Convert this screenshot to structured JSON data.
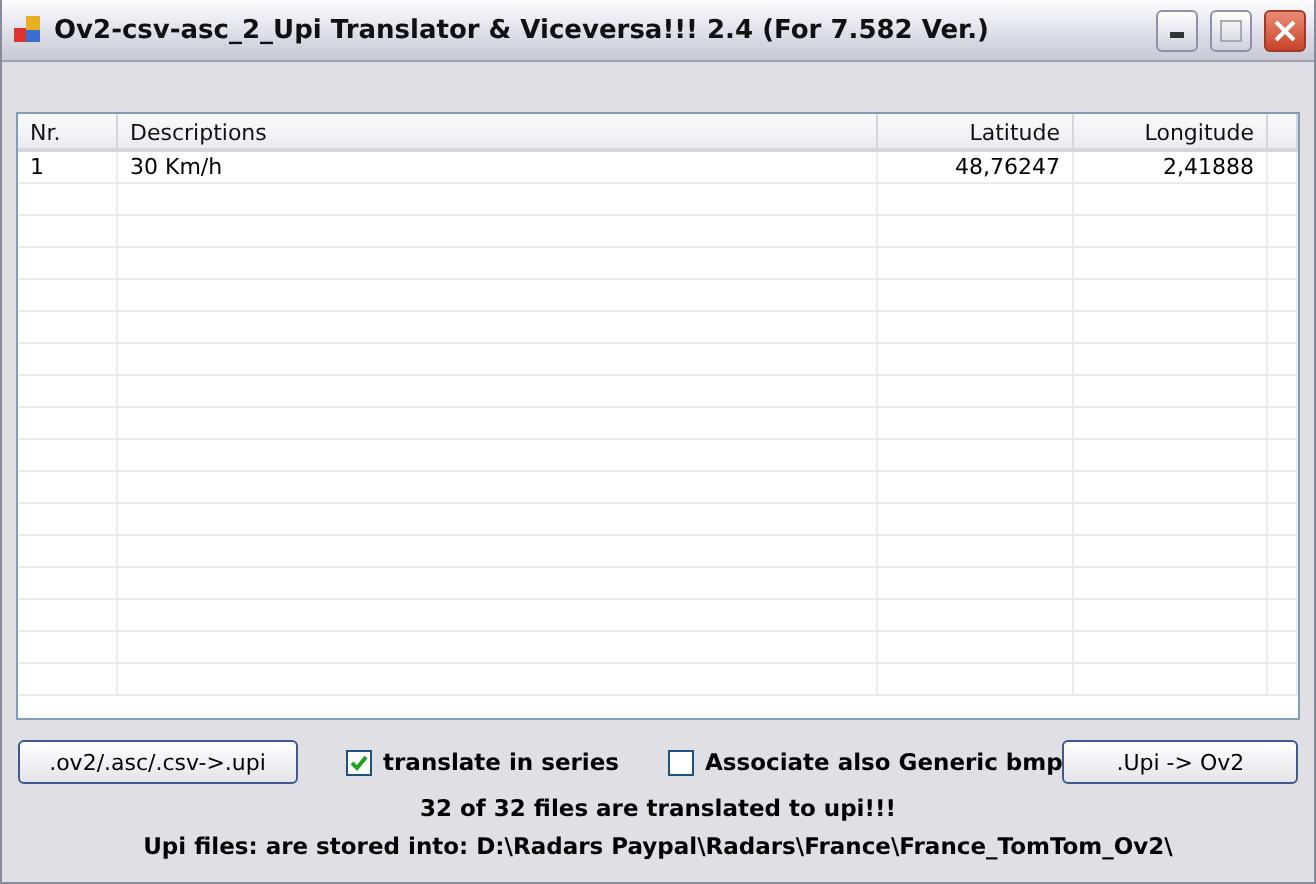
{
  "window": {
    "title": "Ov2-csv-asc_2_Upi Translator & Viceversa!!! 2.4 (For 7.582 Ver.)"
  },
  "table": {
    "columns": [
      {
        "label": "Nr."
      },
      {
        "label": "Descriptions"
      },
      {
        "label": "Latitude"
      },
      {
        "label": "Longitude"
      }
    ],
    "rows": [
      [
        "1",
        "30 Km/h",
        "48,76247",
        "2,41888"
      ]
    ]
  },
  "controls": [
    {
      "kind": "button",
      "label": ".ov2/.asc/.csv->.upi"
    },
    {
      "kind": "checkbox",
      "label": "translate in series",
      "checked": true
    },
    {
      "kind": "checkbox",
      "label": "Associate also Generic bmp",
      "checked": false
    },
    {
      "kind": "button",
      "label": ".Upi -> Ov2"
    }
  ],
  "status": [
    "32 of 32 files are translated to upi!!!",
    "Upi files: are stored into: D:\\Radars Paypal\\Radars\\France\\France_TomTom_Ov2\\"
  ]
}
